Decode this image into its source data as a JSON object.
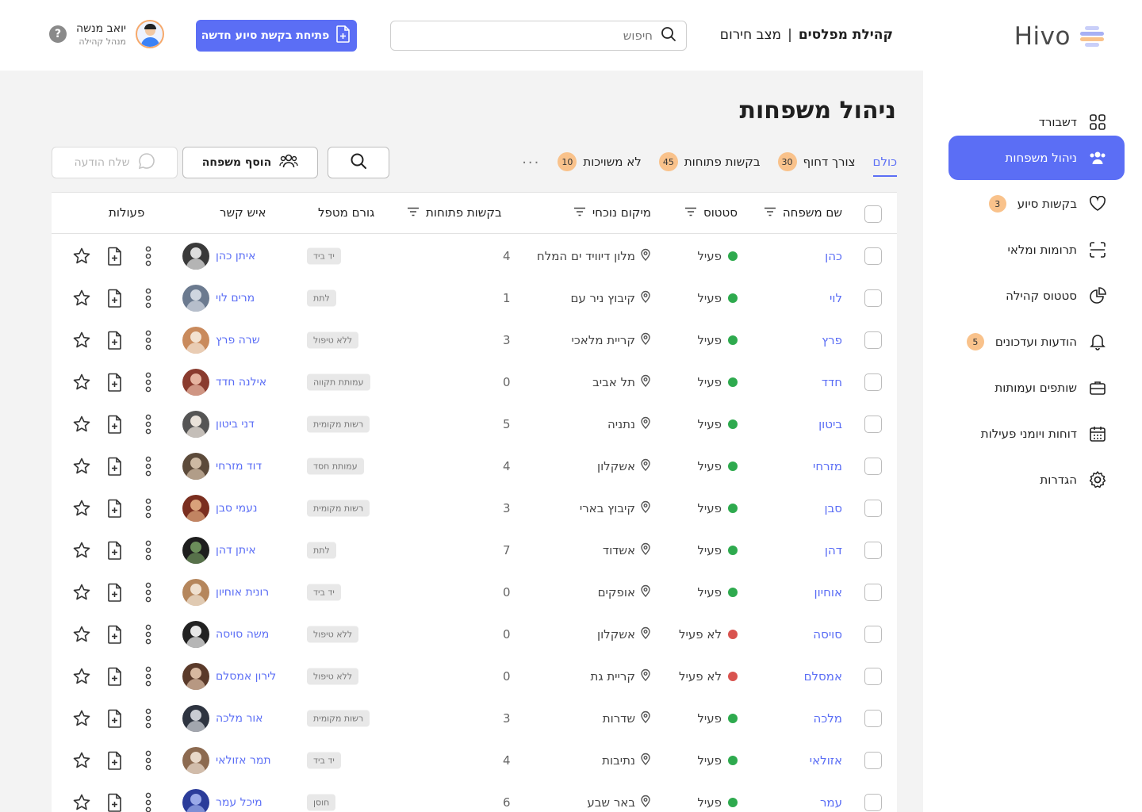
{
  "app": {
    "logo_text": "Hivo"
  },
  "header": {
    "community_name": "קהילת מפלסים",
    "separator": "|",
    "mode": "מצב חירום",
    "search_placeholder": "חיפוש",
    "new_request_label": "פתיחת בקשת סיוע חדשה",
    "user_name": "יואב מנשה",
    "user_role": "מנהל קהילה",
    "help_symbol": "?"
  },
  "sidebar": {
    "items": [
      {
        "label": "דשבורד",
        "icon": "grid-icon",
        "active": false,
        "badge": ""
      },
      {
        "label": "ניהול משפחות",
        "icon": "users-icon",
        "active": true,
        "badge": ""
      },
      {
        "label": "בקשות סיוע",
        "icon": "heart-icon",
        "active": false,
        "badge": "3"
      },
      {
        "label": "תרומות ומלאי",
        "icon": "scan-icon",
        "active": false,
        "badge": ""
      },
      {
        "label": "סטטוס קהילה",
        "icon": "pie-chart-icon",
        "active": false,
        "badge": ""
      },
      {
        "label": "הודעות ועדכונים",
        "icon": "bell-icon",
        "active": false,
        "badge": "5"
      },
      {
        "label": "שותפים ועמותות",
        "icon": "briefcase-icon",
        "active": false,
        "badge": ""
      },
      {
        "label": "דוחות ויומני פעילות",
        "icon": "calendar-icon",
        "active": false,
        "badge": ""
      },
      {
        "label": "הגדרות",
        "icon": "gear-icon",
        "active": false,
        "badge": ""
      }
    ]
  },
  "main": {
    "title": "ניהול משפחות",
    "tabs": [
      {
        "label": "כולם",
        "badge": "",
        "active": true
      },
      {
        "label": "צורך דחוף",
        "badge": "30",
        "active": false
      },
      {
        "label": "בקשות פתוחות",
        "badge": "45",
        "active": false
      },
      {
        "label": "לא משויכות",
        "badge": "10",
        "active": false
      }
    ],
    "more_symbol": "···",
    "add_family_label": "הוסף משפחה",
    "send_message_label": "שלח הודעה"
  },
  "table": {
    "columns": {
      "family": "שם משפחה",
      "status": "סטטוס",
      "location": "מיקום נוכחי",
      "requests": "בקשות פתוחות",
      "handler": "גורם מטפל",
      "contact": "איש קשר",
      "actions": "פעולות"
    },
    "rows": [
      {
        "family": "כהן",
        "status": "פעיל",
        "active": true,
        "location": "מלון דיוויד ים המלח",
        "requests": "4",
        "handler": "יד ביד",
        "contact": "איתן כהן"
      },
      {
        "family": "לוי",
        "status": "פעיל",
        "active": true,
        "location": "קיבוץ ניר עם",
        "requests": "1",
        "handler": "לתת",
        "contact": "מרים לוי"
      },
      {
        "family": "פרץ",
        "status": "פעיל",
        "active": true,
        "location": "קריית מלאכי",
        "requests": "3",
        "handler": "ללא טיפול",
        "contact": "שרה פרץ"
      },
      {
        "family": "חדד",
        "status": "פעיל",
        "active": true,
        "location": "תל אביב",
        "requests": "0",
        "handler": "עמותת תקווה",
        "contact": "אילנה חדד"
      },
      {
        "family": "ביטון",
        "status": "פעיל",
        "active": true,
        "location": "נתניה",
        "requests": "5",
        "handler": "רשות מקומית",
        "contact": "דני ביטון"
      },
      {
        "family": "מזרחי",
        "status": "פעיל",
        "active": true,
        "location": "אשקלון",
        "requests": "4",
        "handler": "עמותת חסד",
        "contact": "דוד מזרחי"
      },
      {
        "family": "סבן",
        "status": "פעיל",
        "active": true,
        "location": "קיבוץ בארי",
        "requests": "3",
        "handler": "רשות מקומית",
        "contact": "נעמי סבן"
      },
      {
        "family": "דהן",
        "status": "פעיל",
        "active": true,
        "location": "אשדוד",
        "requests": "7",
        "handler": "לתת",
        "contact": "איתן דהן"
      },
      {
        "family": "אוחיון",
        "status": "פעיל",
        "active": true,
        "location": "אופקים",
        "requests": "0",
        "handler": "יד ביד",
        "contact": "רונית אוחיון"
      },
      {
        "family": "סויסה",
        "status": "לא פעיל",
        "active": false,
        "location": "אשקלון",
        "requests": "0",
        "handler": "ללא טיפול",
        "contact": "משה סויסה"
      },
      {
        "family": "אמסלם",
        "status": "לא פעיל",
        "active": false,
        "location": "קריית גת",
        "requests": "0",
        "handler": "ללא טיפול",
        "contact": "לירון אמסלם"
      },
      {
        "family": "מלכה",
        "status": "פעיל",
        "active": true,
        "location": "שדרות",
        "requests": "3",
        "handler": "רשות מקומית",
        "contact": "אור מלכה"
      },
      {
        "family": "אזולאי",
        "status": "פעיל",
        "active": true,
        "location": "נתיבות",
        "requests": "4",
        "handler": "יד ביד",
        "contact": "תמר אזולאי"
      },
      {
        "family": "עמר",
        "status": "פעיל",
        "active": true,
        "location": "באר שבע",
        "requests": "6",
        "handler": "חוסן",
        "contact": "מיכל עמר"
      }
    ]
  },
  "colors": {
    "accent": "#5b6ef5",
    "badge": "#f9c28b",
    "active_dot": "#2eaa4e",
    "inactive_dot": "#d9534f"
  }
}
